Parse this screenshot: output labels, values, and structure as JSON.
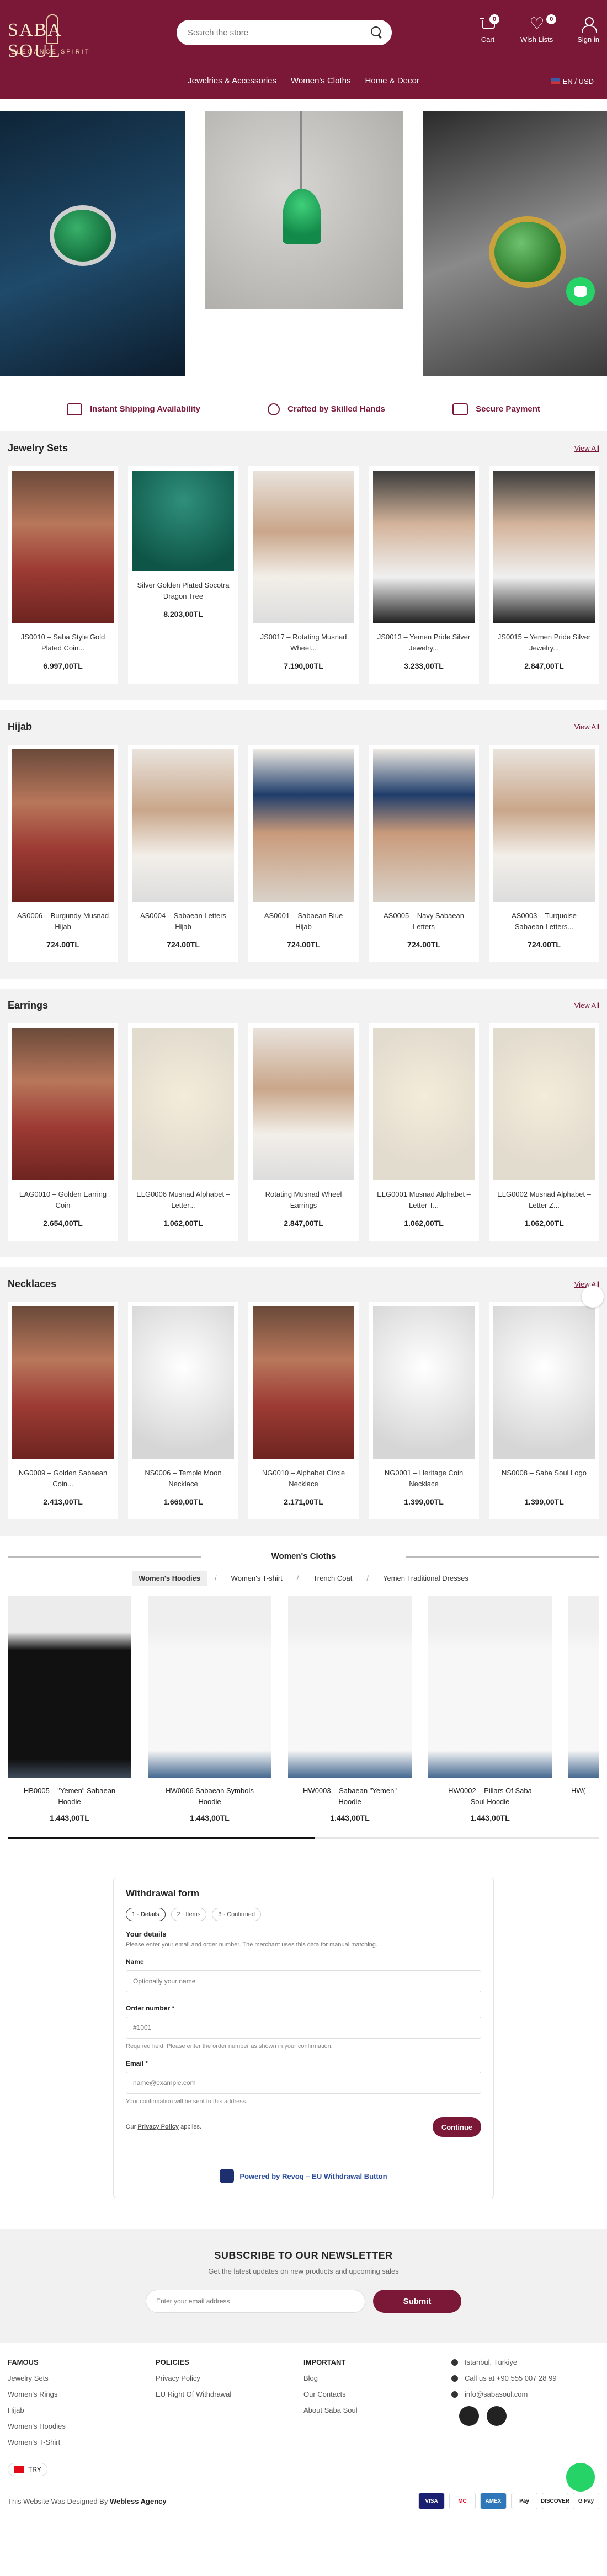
{
  "header": {
    "logo_text": "SABA SOUL",
    "logo_tagline": "ELEGANCE SPIRIT",
    "search_placeholder": "Search the store",
    "cart_label": "Cart",
    "cart_count": "0",
    "wishlist_label": "Wish Lists",
    "wishlist_count": "0",
    "signin_label": "Sign in",
    "locale": "EN / USD"
  },
  "nav": {
    "items": [
      "Jewelries & Accessories",
      "Women's Cloths",
      "Home & Decor"
    ]
  },
  "features": [
    "Instant Shipping Availability",
    "Crafted by Skilled Hands",
    "Secure Payment"
  ],
  "view_all_label": "View All",
  "sections": [
    {
      "title": "Jewelry Sets",
      "products": [
        {
          "name": "JS0010 – Saba Style Gold Plated Coin...",
          "price": "6.997,00TL"
        },
        {
          "name": "Silver Golden Plated Socotra Dragon Tree",
          "price": "8.203,00TL"
        },
        {
          "name": "JS0017 – Rotating Musnad Wheel...",
          "price": "7.190,00TL"
        },
        {
          "name": "JS0013 – Yemen Pride Silver Jewelry...",
          "price": "3.233,00TL"
        },
        {
          "name": "JS0015 – Yemen Pride Silver Jewelry...",
          "price": "2.847,00TL"
        }
      ]
    },
    {
      "title": "Hijab",
      "products": [
        {
          "name": "AS0006 – Burgundy Musnad Hijab",
          "price": "724.00TL"
        },
        {
          "name": "AS0004 – Sabaean Letters Hijab",
          "price": "724.00TL"
        },
        {
          "name": "AS0001 – Sabaean Blue Hijab",
          "price": "724.00TL"
        },
        {
          "name": "AS0005 – Navy Sabaean Letters",
          "price": "724.00TL"
        },
        {
          "name": "AS0003 – Turquoise Sabaean Letters...",
          "price": "724.00TL"
        }
      ]
    },
    {
      "title": "Earrings",
      "products": [
        {
          "name": "EAG0010 – Golden Earring Coin",
          "price": "2.654,00TL"
        },
        {
          "name": "ELG0006 Musnad Alphabet – Letter...",
          "price": "1.062,00TL"
        },
        {
          "name": "Rotating Musnad Wheel Earrings",
          "price": "2.847,00TL"
        },
        {
          "name": "ELG0001 Musnad Alphabet – Letter T...",
          "price": "1.062,00TL"
        },
        {
          "name": "ELG0002 Musnad Alphabet – Letter Z...",
          "price": "1.062,00TL"
        }
      ]
    },
    {
      "title": "Necklaces",
      "products": [
        {
          "name": "NG0009 – Golden Sabaean Coin...",
          "price": "2.413,00TL"
        },
        {
          "name": "NS0006 – Temple Moon Necklace",
          "price": "1.669,00TL"
        },
        {
          "name": "NG0010 – Alphabet Circle Necklace",
          "price": "2.171,00TL"
        },
        {
          "name": "NG0001 – Heritage Coin Necklace",
          "price": "1.399,00TL"
        },
        {
          "name": "NS0008 – Saba Soul Logo",
          "price": "1.399,00TL"
        }
      ]
    }
  ],
  "clothes": {
    "title": "Women's Cloths",
    "tabs": [
      "Women's Hoodies",
      "Women's T-shirt",
      "Trench Coat",
      "Yemen Traditional Dresses"
    ],
    "tab_separator": "/",
    "products": [
      {
        "name": "HB0005 – \"Yemen\" Sabaean Hoodie",
        "price": "1.443,00TL"
      },
      {
        "name": "HW0006 Sabaean Symbols Hoodie",
        "price": "1.443,00TL"
      },
      {
        "name": "HW0003 – Sabaean \"Yemen\" Hoodie",
        "price": "1.443,00TL"
      },
      {
        "name": "HW0002 – Pillars Of Saba Soul Hoodie",
        "price": "1.443,00TL"
      },
      {
        "name": "HW(",
        "price": ""
      }
    ],
    "progress_fraction": 0.52
  },
  "withdrawal": {
    "title": "Withdrawal form",
    "steps": [
      "1 · Details",
      "2 · Items",
      "3 · Confirmed"
    ],
    "subtitle": "Your details",
    "description": "Please enter your email and order number. The merchant uses this data for manual matching.",
    "name_label": "Name",
    "name_placeholder": "Optionally your name",
    "order_label": "Order number *",
    "order_placeholder": "#1001",
    "order_help": "Required field. Please enter the order number as shown in your confirmation.",
    "email_label": "Email *",
    "email_placeholder": "name@example.com",
    "email_help": "Your confirmation will be sent to this address.",
    "policy_prefix": "Our",
    "policy_link": "Privacy Policy",
    "policy_suffix": "applies.",
    "continue_label": "Continue",
    "powered_label": "Powered by Revoq – EU Withdrawal Button"
  },
  "newsletter": {
    "title": "SUBSCRIBE TO OUR NEWSLETTER",
    "subtitle": "Get the latest updates on new products and upcoming sales",
    "placeholder": "Enter your email address",
    "button": "Submit"
  },
  "footer": {
    "famous": {
      "title": "FAMOUS",
      "links": [
        "Jewelry Sets",
        "Women's Rings",
        "Hijab",
        "Women's Hoodies",
        "Women's T-Shirt"
      ]
    },
    "policies": {
      "title": "POLICIES",
      "links": [
        "Privacy Policy",
        "EU Right Of Withdrawal"
      ]
    },
    "important": {
      "title": "IMPORTANT",
      "links": [
        "Blog",
        "Our Contacts",
        "About Saba Soul"
      ]
    },
    "contact": [
      "Istanbul, Türkiye",
      "Call us at +90 555 007 28 99",
      "info@sabasoul.com"
    ],
    "currency": "TRY",
    "credit_prefix": "This Website Was Designed By",
    "credit_name": "Webless Agency",
    "payments": [
      "VISA",
      "MC",
      "AMEX",
      "Pay",
      "DISCOVER",
      "G Pay"
    ]
  }
}
